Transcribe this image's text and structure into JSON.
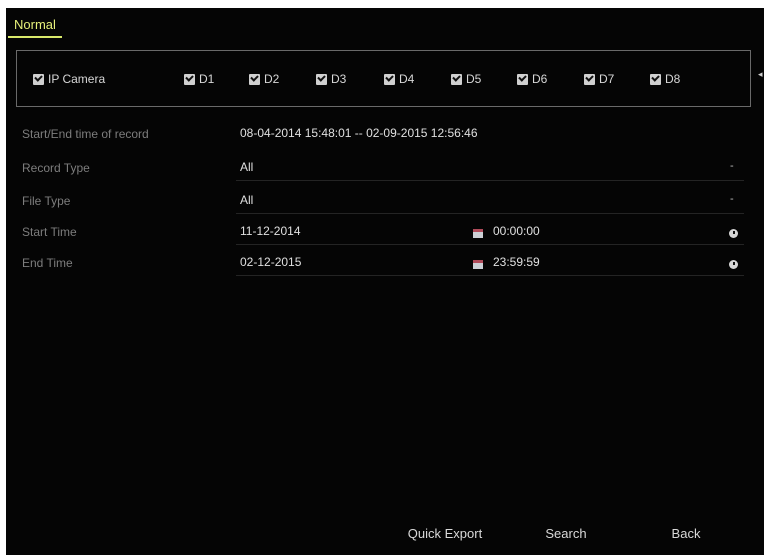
{
  "tab": {
    "label": "Normal"
  },
  "channels": [
    {
      "label": "IP Camera",
      "checked": true
    },
    {
      "label": "D1",
      "checked": true
    },
    {
      "label": "D2",
      "checked": true
    },
    {
      "label": "D3",
      "checked": true
    },
    {
      "label": "D4",
      "checked": true
    },
    {
      "label": "D5",
      "checked": true
    },
    {
      "label": "D6",
      "checked": true
    },
    {
      "label": "D7",
      "checked": true
    },
    {
      "label": "D8",
      "checked": true
    }
  ],
  "form": {
    "record_range": {
      "label": "Start/End time of record",
      "value": "08-04-2014 15:48:01 -- 02-09-2015 12:56:46"
    },
    "record_type": {
      "label": "Record Type",
      "value": "All"
    },
    "file_type": {
      "label": "File Type",
      "value": "All"
    },
    "start_time": {
      "label": "Start Time",
      "date": "11-12-2014",
      "time": "00:00:00"
    },
    "end_time": {
      "label": "End Time",
      "date": "02-12-2015",
      "time": "23:59:59"
    }
  },
  "buttons": {
    "quick_export": "Quick Export",
    "search": "Search",
    "back": "Back"
  },
  "icons": {
    "calendar": "calendar-icon",
    "clock": "clock-icon",
    "checkbox": "checkbox-checked-icon",
    "dropdown": "dropdown-icon"
  },
  "colors": {
    "background": "#050505",
    "tab_accent": "#e6f07a",
    "label": "#7d7d7d",
    "value": "#e0e0e0"
  }
}
